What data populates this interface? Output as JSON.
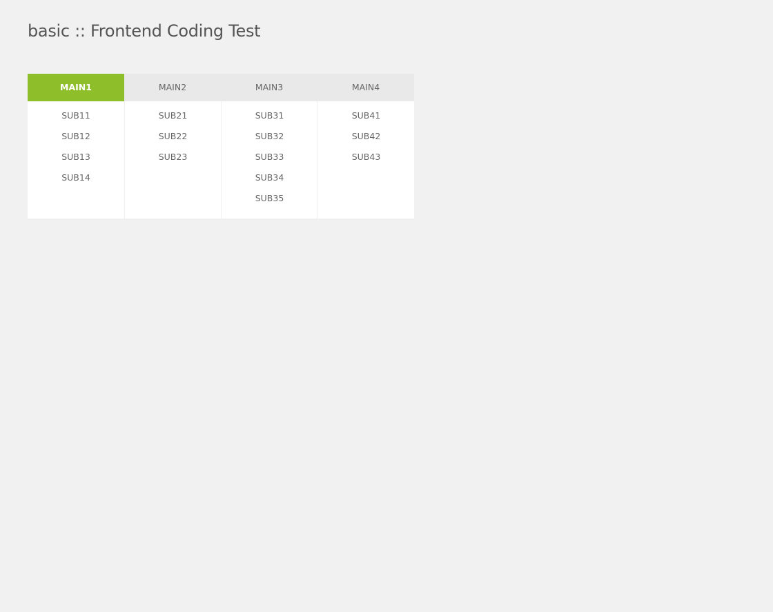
{
  "page": {
    "title": "basic :: Frontend Coding Test"
  },
  "colors": {
    "active_tab": "#8fbe2b",
    "inactive_tab": "#e9e9e9",
    "background": "#f1f1f1",
    "submenu_background": "#ffffff",
    "text": "#666666"
  },
  "menu": {
    "active_index": 0,
    "items": [
      {
        "label": "MAIN1",
        "subs": [
          "SUB11",
          "SUB12",
          "SUB13",
          "SUB14"
        ]
      },
      {
        "label": "MAIN2",
        "subs": [
          "SUB21",
          "SUB22",
          "SUB23"
        ]
      },
      {
        "label": "MAIN3",
        "subs": [
          "SUB31",
          "SUB32",
          "SUB33",
          "SUB34",
          "SUB35"
        ]
      },
      {
        "label": "MAIN4",
        "subs": [
          "SUB41",
          "SUB42",
          "SUB43"
        ]
      }
    ]
  }
}
